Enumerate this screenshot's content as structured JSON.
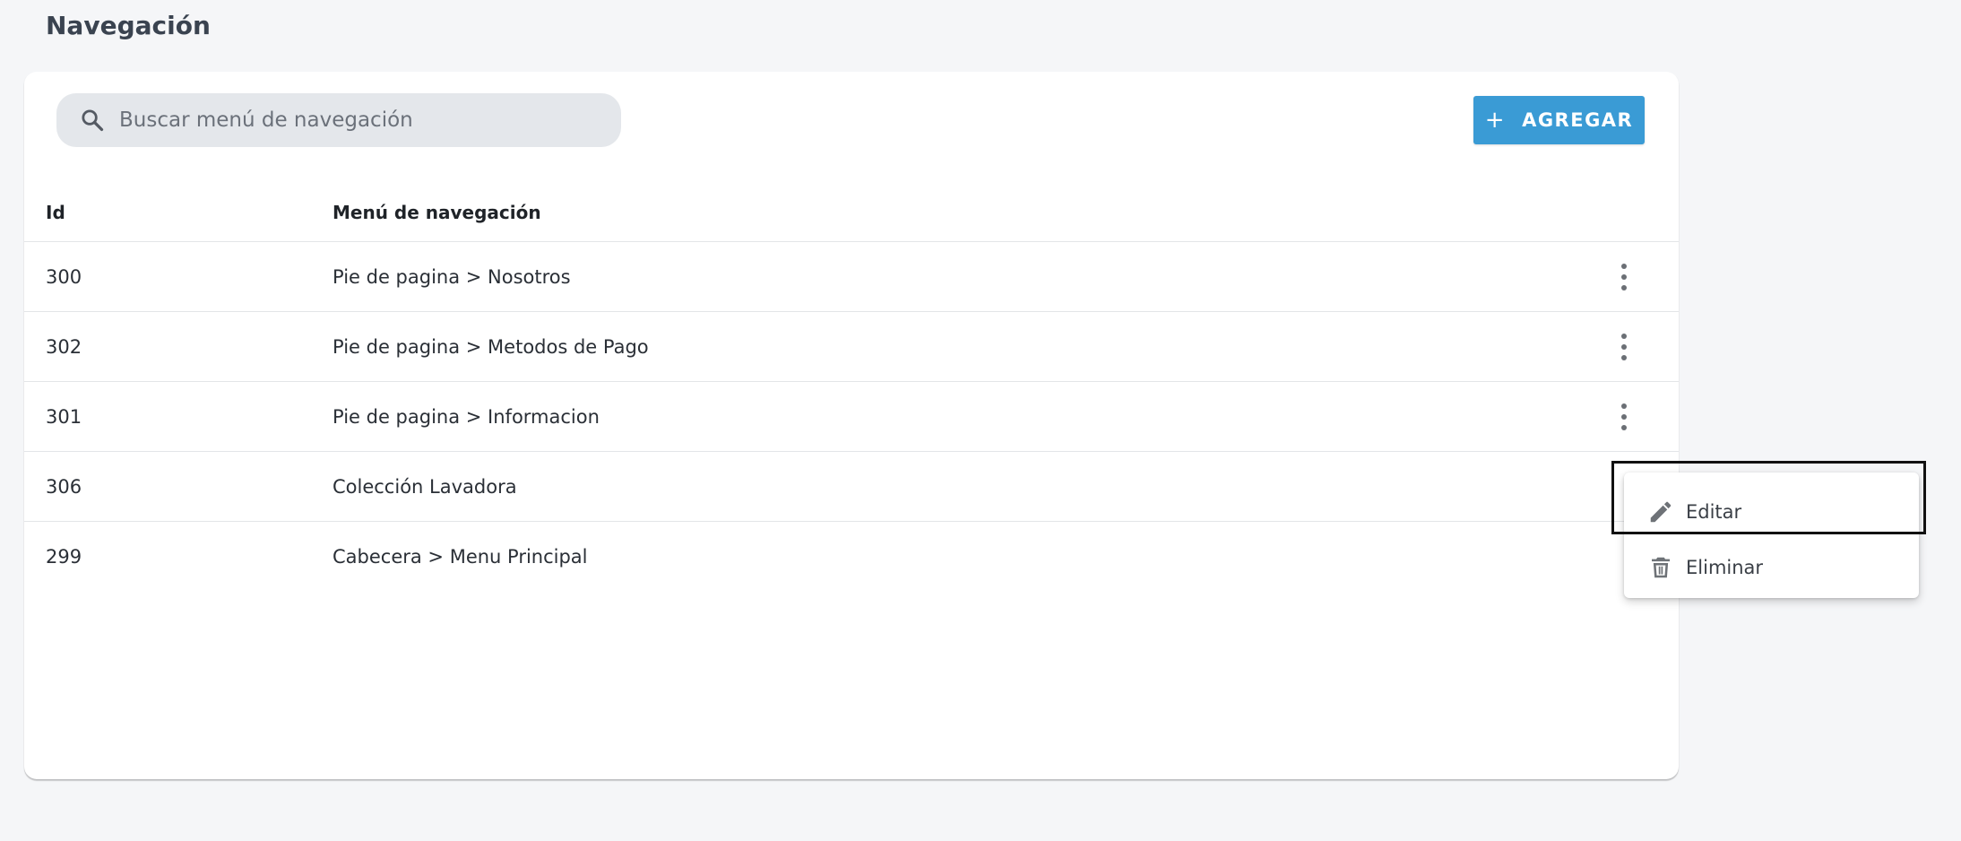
{
  "header": {
    "title": "Navegación"
  },
  "search": {
    "placeholder": "Buscar menú de navegación",
    "value": ""
  },
  "toolbar": {
    "add_label": "AGREGAR",
    "accent": "#3a9bd5"
  },
  "table": {
    "columns": [
      "Id",
      "Menú de navegación"
    ],
    "rows": [
      {
        "id": "300",
        "name": "Pie de pagina > Nosotros"
      },
      {
        "id": "302",
        "name": "Pie de pagina > Metodos de Pago"
      },
      {
        "id": "301",
        "name": "Pie de pagina > Informacion"
      },
      {
        "id": "306",
        "name": "Colección Lavadora"
      },
      {
        "id": "299",
        "name": "Cabecera > Menu Principal"
      }
    ]
  },
  "context_menu": {
    "items": [
      {
        "label": "Editar",
        "icon": "pencil-icon"
      },
      {
        "label": "Eliminar",
        "icon": "trash-icon"
      }
    ]
  }
}
